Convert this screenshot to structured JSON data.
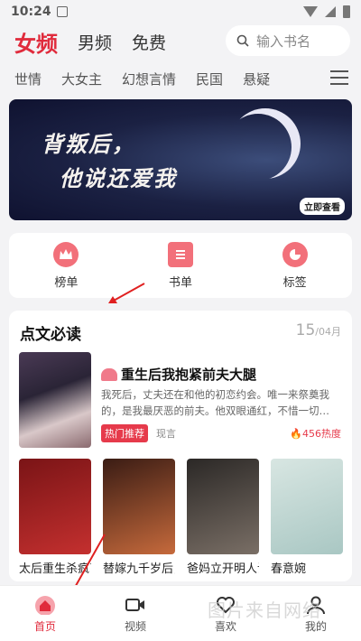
{
  "status": {
    "time": "10:24"
  },
  "top_tabs": [
    {
      "label": "女频"
    },
    {
      "label": "男频"
    },
    {
      "label": "免费"
    }
  ],
  "search": {
    "placeholder": "输入书名"
  },
  "categories": [
    "世情",
    "大女主",
    "幻想言情",
    "民国",
    "悬疑"
  ],
  "banner": {
    "line1": "背叛后，",
    "line2": "他说还爱我",
    "button": "立即查看"
  },
  "shortcuts": [
    {
      "label": "榜单",
      "icon": "crown-icon"
    },
    {
      "label": "书单",
      "icon": "book-list-icon"
    },
    {
      "label": "标签",
      "icon": "tag-icon"
    }
  ],
  "section": {
    "title": "点文必读",
    "day": "15",
    "month": "/04月",
    "featured": {
      "title": "重生后我抱紧前夫大腿",
      "description": "我死后，丈夫还在和他的初恋约会。唯一来祭奠我的，是我最厌恶的前夫。他双眼通红，不惜一切…",
      "tag": "热门推荐",
      "genre": "现言",
      "heat": "456热度"
    },
    "books": [
      {
        "name": "太后重生杀疯了",
        "colors": [
          "#7a1416",
          "#c4302f"
        ]
      },
      {
        "name": "替嫁九千岁后，我杀疯了",
        "colors": [
          "#3a1c14",
          "#c66a3c"
        ]
      },
      {
        "name": "爸妈立开明人设逼死我后",
        "colors": [
          "#2b2826",
          "#7a6f66"
        ]
      },
      {
        "name": "春意婉",
        "colors": [
          "#d8e6e2",
          "#a9c7c3"
        ]
      }
    ]
  },
  "bottom_nav": [
    {
      "label": "首页",
      "icon": "home-icon",
      "active": true
    },
    {
      "label": "视频",
      "icon": "video-icon"
    },
    {
      "label": "喜欢",
      "icon": "heart-icon"
    },
    {
      "label": "我的",
      "icon": "user-icon"
    }
  ],
  "watermark": "图片来自网络",
  "colors": {
    "accent": "#e02b3c",
    "tag": "#e63a4b"
  }
}
